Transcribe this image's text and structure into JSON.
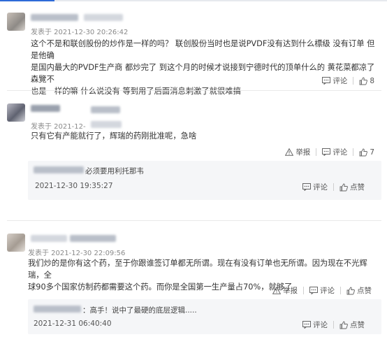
{
  "comments": [
    {
      "meta": "发表于 2021-12-30 20:26:42",
      "lines": [
        "这个不是和联创股份的炒作是一样的吗？ 联创股份当时也是说PVDF没有达到什么標级 没有订单 但是他确",
        "是国内最大的PVDF生产商 都炒完了 到这个月的时候才说接到宁德时代的顶单什么的 黄花菜都凉了 森覽不",
        "也是一样的嘛 什么说没有 等到用了后面消息刺激了就很难搞"
      ],
      "comment_label": "评论",
      "like_count": "8"
    },
    {
      "meta": "发表于 2021-12-",
      "lines": [
        "只有它有产能就行了，辉瑞的药刚批准呢，急啥"
      ],
      "report_label": "举报",
      "comment_label": "评论",
      "like_count": "7",
      "reply": {
        "text": "必须要用利托那韦",
        "time": "2021-12-30 19:35:27",
        "comment_label": "评论",
        "like_label": "点赞"
      }
    },
    {
      "meta": "发表于 2021-12-30 22:09:56",
      "lines": [
        "我们炒的是你有这个药，至于你跟谁签订单都无所谓。现在有没有订单也无所谓。因为现在不光辉瑞，全",
        "球90多个国家仿制药都需要这个药。而你是全国第一生产量占70%，就够了"
      ],
      "report_label": "举报",
      "comment_label": "评论",
      "like_label": "点赞",
      "reply": {
        "text": "：高手！说中了最硬的底层逻辑.....",
        "time": "2021-12-31 06:40:40",
        "comment_label": "评论",
        "like_label": "点赞"
      }
    }
  ]
}
